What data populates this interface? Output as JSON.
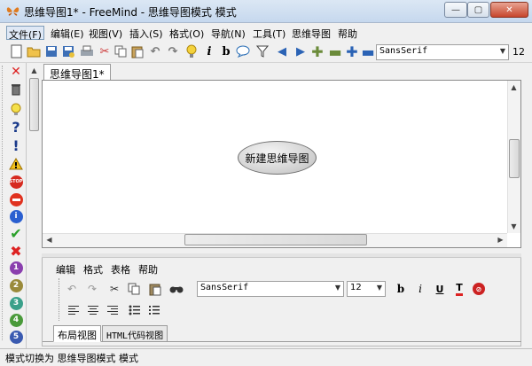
{
  "window": {
    "title": "思维导图1* - FreeMind - 思维导图模式 模式"
  },
  "menubar": {
    "items": [
      "文件(F)",
      "编辑(E)",
      "视图(V)",
      "插入(S)",
      "格式(O)",
      "导航(N)",
      "工具(T)",
      "思维导图",
      "帮助"
    ]
  },
  "toolbar": {
    "font_family": "SansSerif",
    "font_size": "12"
  },
  "map": {
    "tab_label": "思维导图1*",
    "root_node": "新建思维导图"
  },
  "note_editor": {
    "menu": [
      "编辑",
      "格式",
      "表格",
      "帮助"
    ],
    "font_family": "SansSerif",
    "font_size": "12",
    "tabs": [
      "布局视图",
      "HTML代码视图"
    ]
  },
  "statusbar": {
    "text": "模式切换为 思维导图模式 模式"
  },
  "left_icons": [
    "delete-icon",
    "trash-icon",
    "idea-icon",
    "question-icon",
    "exclamation-icon",
    "warning-icon",
    "stop-icon",
    "no-entry-icon",
    "info-icon",
    "check-icon",
    "cross-icon",
    "priority-1-icon",
    "priority-2-icon",
    "priority-3-icon",
    "priority-4-icon",
    "priority-5-icon"
  ]
}
